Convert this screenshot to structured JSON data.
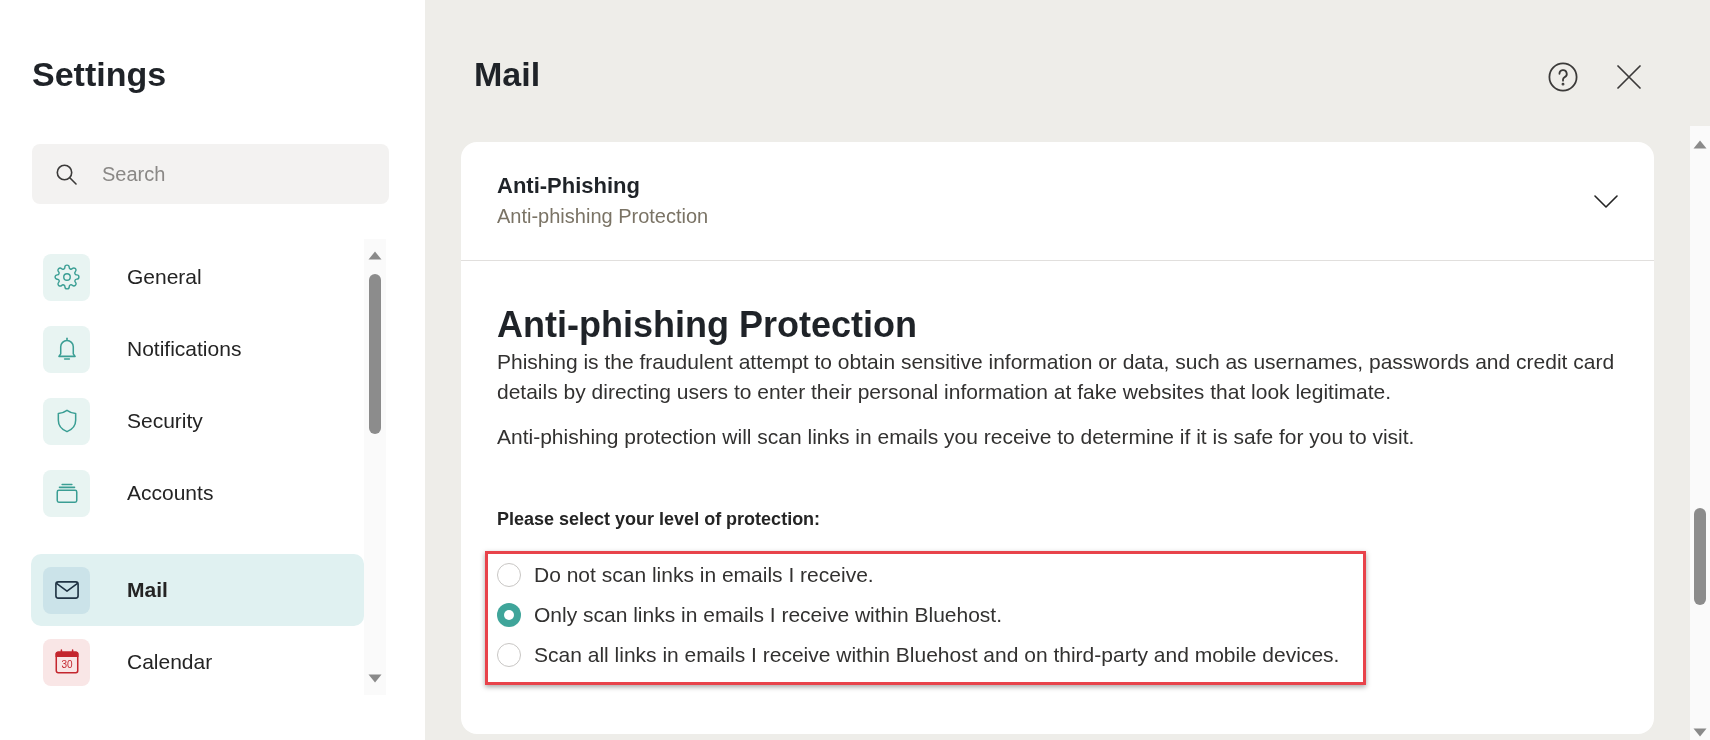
{
  "sidebar": {
    "title": "Settings",
    "search": {
      "placeholder": "Search"
    },
    "groups": [
      {
        "items": [
          {
            "kind": "gear",
            "label": "General",
            "selected": false
          },
          {
            "kind": "bell",
            "label": "Notifications",
            "selected": false
          },
          {
            "kind": "shield",
            "label": "Security",
            "selected": false
          },
          {
            "kind": "stack",
            "label": "Accounts",
            "selected": false
          }
        ]
      },
      {
        "items": [
          {
            "kind": "envelope",
            "label": "Mail",
            "selected": true
          },
          {
            "kind": "calendar",
            "label": "Calendar",
            "icon_text": "30",
            "selected": false
          }
        ]
      }
    ]
  },
  "main": {
    "title": "Mail",
    "section": {
      "title": "Anti-Phishing",
      "subtitle": "Anti-phishing Protection",
      "expanded": true,
      "heading": "Anti-phishing Protection",
      "paragraphs": [
        "Phishing is the fraudulent attempt to obtain sensitive information or data, such as usernames, passwords and credit card details by directing users to enter their personal information at fake websites that look legitimate.",
        "Anti-phishing protection will scan links in emails you receive to determine if it is safe for you to visit."
      ],
      "prompt": "Please select your level of protection:",
      "options_highlighted": true,
      "options": [
        {
          "label": "Do not scan links in emails I receive.",
          "selected": false
        },
        {
          "label": "Only scan links in emails I receive within Bluehost.",
          "selected": true
        },
        {
          "label": "Scan all links in emails I receive within Bluehost and on third-party and mobile devices.",
          "selected": false
        }
      ]
    }
  }
}
